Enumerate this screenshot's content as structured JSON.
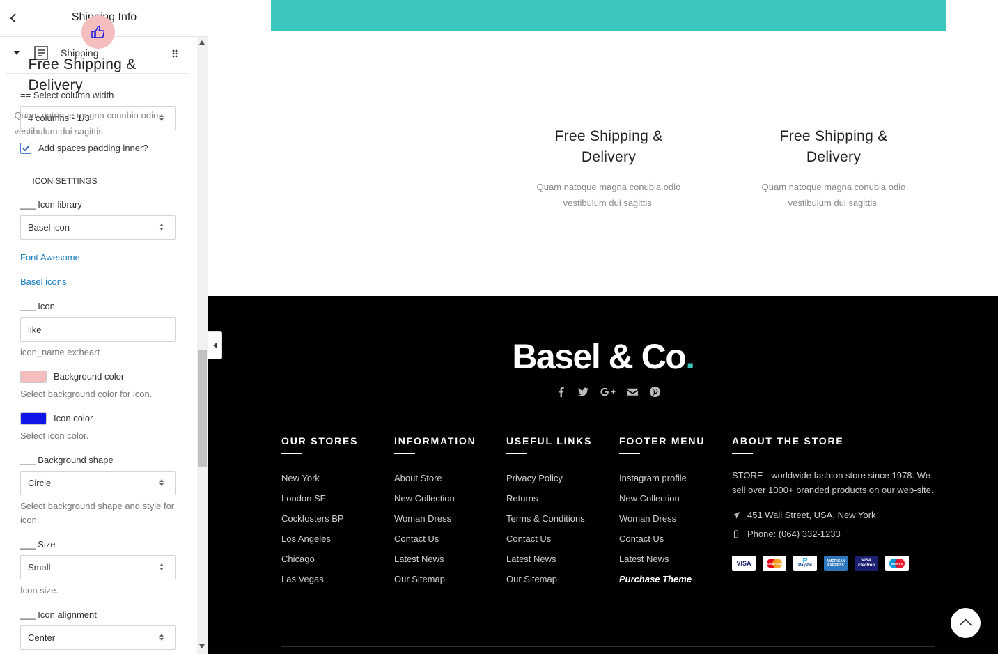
{
  "panel": {
    "title": "Shipping Info",
    "element_label": "Shipping",
    "column_width_label": "== Select column width",
    "column_width_value": "4 columns - 1/3",
    "padding_label": "Add spaces padding inner?",
    "icon_settings_heading": "== ICON SETTINGS",
    "icon_library_label": "___ Icon library",
    "icon_library_value": "Basel icon",
    "font_awesome_link": "Font Awesome",
    "basel_icons_link": "Basel icons",
    "icon_label": "___ Icon",
    "icon_value": "like",
    "icon_hint": "icon_name ex:heart",
    "bg_color_label": "Background color",
    "bg_color_hint": "Select background color for icon.",
    "bg_color": "#f5bebe",
    "icon_color_label": "Icon color",
    "icon_color_hint": "Select icon color.",
    "icon_color": "#1016e8",
    "bg_shape_label": "___ Background shape",
    "bg_shape_value": "Circle",
    "bg_shape_hint": "Select background shape and style for icon.",
    "size_label": "___ Size",
    "size_value": "Small",
    "size_hint": "Icon size.",
    "alignment_label": "___ Icon alignment",
    "alignment_value": "Center"
  },
  "preview": {
    "banner_color": "#3cc6c0",
    "boxes": [
      {
        "title": "Free Shipping & Delivery",
        "desc": "Quam natoque magna conubia odio vestibulum dui sagittis."
      },
      {
        "title": "Free Shipping & Delivery",
        "desc": "Quam natoque magna conubia odio vestibulum dui sagittis."
      },
      {
        "title": "Free Shipping & Delivery",
        "desc": "Quam natoque magna conubia odio vestibulum dui sagittis."
      }
    ]
  },
  "footer": {
    "logo_main": "Basel & Co",
    "logo_dot": ".",
    "accent": "#3cc6c0",
    "socials": [
      "facebook-icon",
      "twitter-icon",
      "google-plus-icon",
      "envelope-icon",
      "pinterest-icon"
    ],
    "columns": [
      {
        "title": "OUR STORES",
        "links": [
          "New York",
          "London SF",
          "Cockfosters BP",
          "Los Angeles",
          "Chicago",
          "Las Vegas"
        ]
      },
      {
        "title": "INFORMATION",
        "links": [
          "About Store",
          "New Collection",
          "Woman Dress",
          "Contact Us",
          "Latest News",
          "Our Sitemap"
        ]
      },
      {
        "title": "USEFUL LINKS",
        "links": [
          "Privacy Policy",
          "Returns",
          "Terms & Conditions",
          "Contact Us",
          "Latest News",
          "Our Sitemap"
        ]
      },
      {
        "title": "FOOTER MENU",
        "links": [
          "Instagram profile",
          "New Collection",
          "Woman Dress",
          "Contact Us",
          "Latest News",
          "Purchase Theme"
        ]
      }
    ],
    "about": {
      "title": "ABOUT THE STORE",
      "text": "STORE - worldwide fashion store since 1978. We sell over 1000+ branded products on our web-site.",
      "address": "451 Wall Street, USA, New York",
      "phone": "Phone: (064) 332-1233",
      "cards": [
        "VISA",
        "MasterCard",
        "PayPal",
        "AMERICAN EXPRESS",
        "VISA Electron",
        "Maestro"
      ]
    }
  }
}
